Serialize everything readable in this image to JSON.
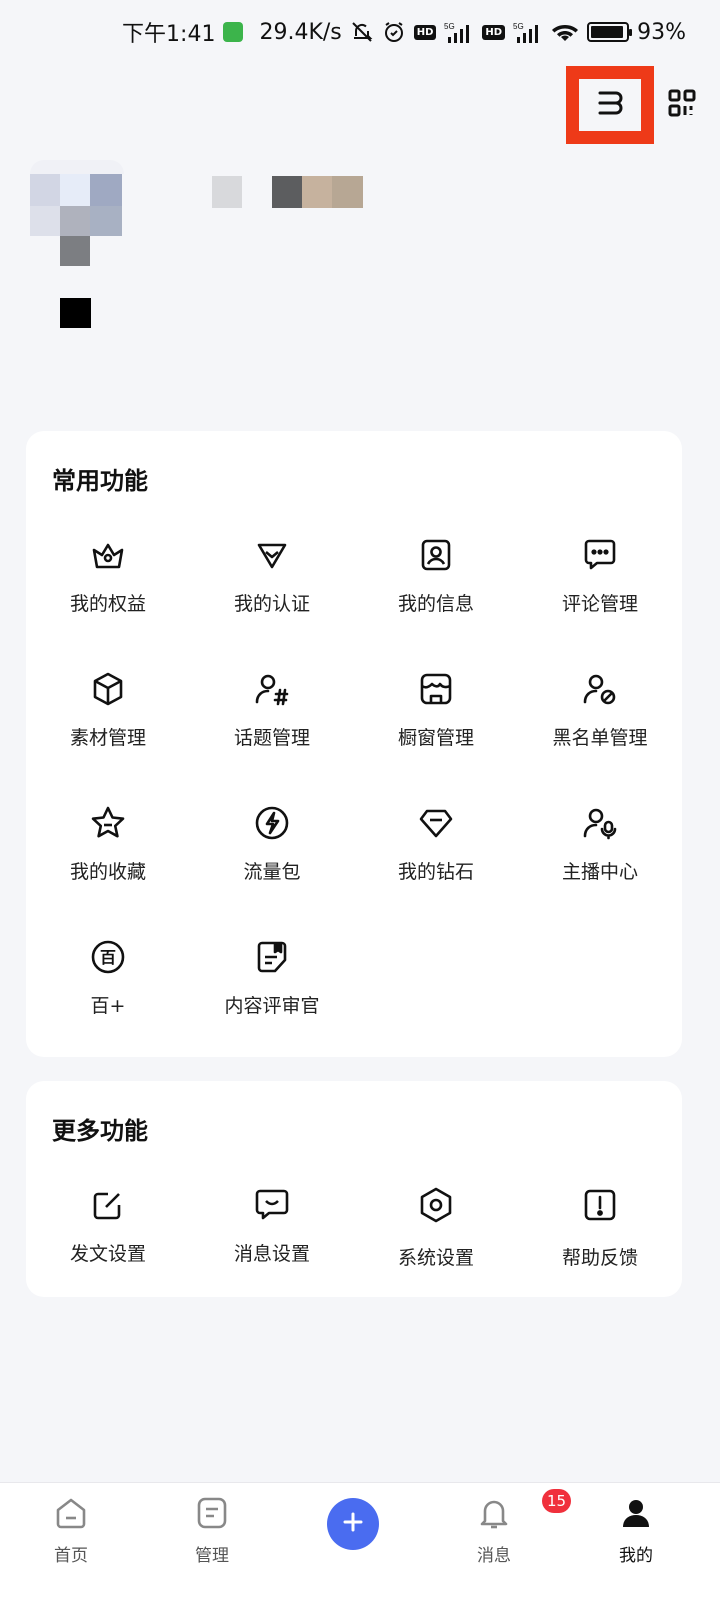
{
  "status_bar": {
    "time": "下午1:41",
    "net_speed": "29.4K/s",
    "hd_label": "HD",
    "net_type": "5G",
    "battery": "93%",
    "battery_level": 0.93
  },
  "top_actions": {
    "left_icon": "toggle-icon",
    "right_icon": "qr-code-icon"
  },
  "common_functions": {
    "title": "常用功能",
    "items": [
      {
        "label": "我的权益",
        "icon": "crown-icon"
      },
      {
        "label": "我的认证",
        "icon": "verify-icon"
      },
      {
        "label": "我的信息",
        "icon": "profile-card-icon"
      },
      {
        "label": "评论管理",
        "icon": "comment-icon"
      },
      {
        "label": "素材管理",
        "icon": "cube-icon"
      },
      {
        "label": "话题管理",
        "icon": "topic-icon"
      },
      {
        "label": "橱窗管理",
        "icon": "shop-icon"
      },
      {
        "label": "黑名单管理",
        "icon": "block-user-icon"
      },
      {
        "label": "我的收藏",
        "icon": "star-icon"
      },
      {
        "label": "流量包",
        "icon": "lightning-icon"
      },
      {
        "label": "我的钻石",
        "icon": "diamond-icon"
      },
      {
        "label": "主播中心",
        "icon": "streamer-icon"
      },
      {
        "label": "百+",
        "icon": "bai-icon"
      },
      {
        "label": "内容评审官",
        "icon": "review-icon"
      }
    ]
  },
  "more_functions": {
    "title": "更多功能",
    "items": [
      {
        "label": "发文设置",
        "icon": "edit-icon"
      },
      {
        "label": "消息设置",
        "icon": "message-icon"
      },
      {
        "label": "系统设置",
        "icon": "settings-icon"
      },
      {
        "label": "帮助反馈",
        "icon": "help-icon"
      }
    ]
  },
  "bottom_nav": {
    "items": [
      {
        "label": "首页",
        "icon": "home-icon"
      },
      {
        "label": "管理",
        "icon": "manage-icon"
      },
      {
        "label": "",
        "icon": "plus-icon"
      },
      {
        "label": "消息",
        "icon": "bell-icon",
        "badge": "15"
      },
      {
        "label": "我的",
        "icon": "user-icon"
      }
    ]
  },
  "colors": {
    "highlight": "#ee3a18",
    "accent": "#4a6cf0",
    "badge": "#f0303c"
  }
}
